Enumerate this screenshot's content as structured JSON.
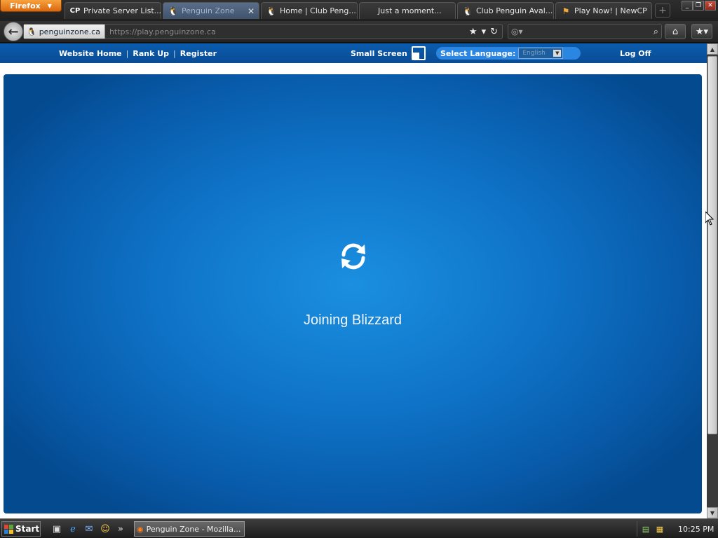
{
  "browser": {
    "menu_button": "Firefox",
    "tabs": [
      {
        "label": "Private Server List...",
        "favicon": "cp-icon"
      },
      {
        "label": "Penguin Zone",
        "favicon": "penguin-icon",
        "active": true
      },
      {
        "label": "Home | Club Peng...",
        "favicon": "penguin-icon"
      },
      {
        "label": "Just a moment...",
        "favicon": "blank-page-icon"
      },
      {
        "label": "Club Penguin Aval...",
        "favicon": "penguin-icon"
      },
      {
        "label": "Play Now! | NewCP",
        "favicon": "newcp-icon"
      }
    ],
    "site_identity": "penguinzone.ca",
    "url": "https://play.penguinzone.ca",
    "search_placeholder": ""
  },
  "site": {
    "nav": [
      "Website Home",
      "Rank Up",
      "Register"
    ],
    "small_screen": "Small Screen",
    "select_language": "Select Language:",
    "language_value": "English",
    "log_off": "Log Off"
  },
  "game": {
    "status_text": "Joining Blizzard",
    "icon": "refresh-icon",
    "colors": {
      "bg_center": "#1b8fe0",
      "bg_edge": "#044a8f",
      "bar": "#0a5cae"
    }
  },
  "taskbar": {
    "start_label": "Start",
    "task_button": "Penguin Zone - Mozilla...",
    "clock": "10:25 PM"
  }
}
